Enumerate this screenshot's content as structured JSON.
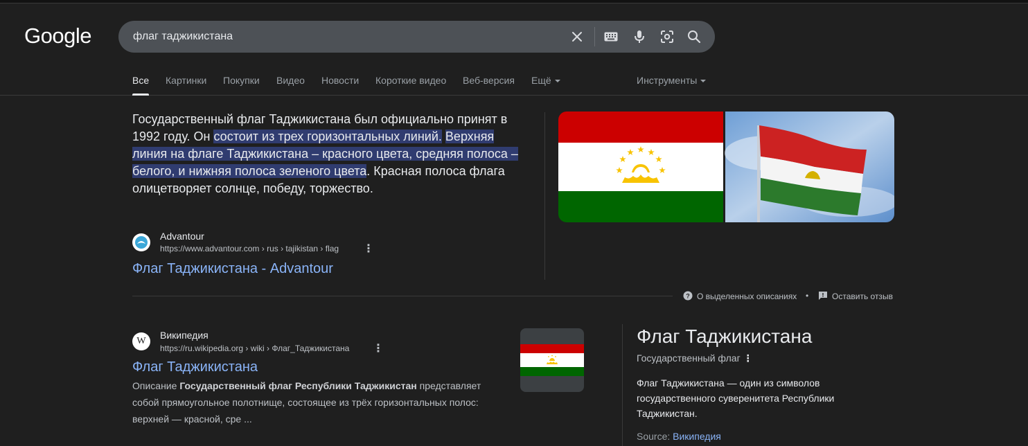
{
  "header": {
    "logo": "Google",
    "search_query": "флаг таджикистана",
    "icons": [
      "clear-icon",
      "keyboard-icon",
      "mic-icon",
      "lens-icon",
      "search-icon"
    ]
  },
  "tabs": [
    {
      "label": "Все",
      "active": true
    },
    {
      "label": "Картинки"
    },
    {
      "label": "Покупки"
    },
    {
      "label": "Видео"
    },
    {
      "label": "Новости"
    },
    {
      "label": "Короткие видео"
    },
    {
      "label": "Веб-версия"
    },
    {
      "label": "Ещё"
    }
  ],
  "tools_label": "Инструменты",
  "featured": {
    "text_before": "Государственный флаг Таджикистана был официально принят в 1992 году. Он ",
    "highlight_1": "состоит из трех горизонтальных линий.",
    "highlight_2": "Верхняя линия на флаге Таджикистана – красного цвета, средняя полоса – белого, и нижняя полоса зеленого цвета",
    "text_after": ". Красная полоса флага олицетворяет солнце, победу, торжество.",
    "source_name": "Advantour",
    "source_url": "https://www.advantour.com › rus › tajikistan › flag",
    "link_title": "Флаг Таджикистана - Advantour"
  },
  "about_bar": {
    "about_label": "О выделенных описаниях",
    "bullet": "•",
    "feedback_label": "Оставить отзыв"
  },
  "result_wiki": {
    "source_name": "Википедия",
    "favicon_letter": "W",
    "source_url": "https://ru.wikipedia.org › wiki › Флаг_Таджикистана",
    "link_title": "Флаг Таджикистана",
    "desc_before": "Описание ",
    "desc_bold": "Государственный флаг Республики Таджикистан",
    "desc_after": " представляет собой прямоугольное полотнище, состоящее из трёх горизонтальных полос: верхней — красной, сре ..."
  },
  "knowledge_panel": {
    "title": "Флаг Таджикистана",
    "subtitle": "Государственный флаг",
    "description": "Флаг Таджикистана — один из символов государственного суверенитета Республики Таджикистан.",
    "source_label": "Source:",
    "source_link": "Википедия"
  },
  "colors": {
    "background": "#1f1f1f",
    "link": "#8ab4f8",
    "highlight": "#303c70",
    "flag_red": "#cc0000",
    "flag_white": "#ffffff",
    "flag_green": "#006600",
    "flag_gold": "#f8c300"
  }
}
